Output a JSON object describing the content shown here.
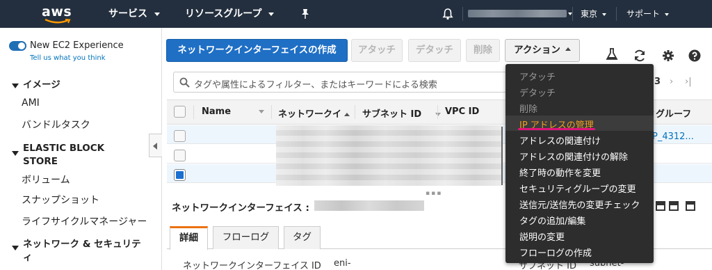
{
  "topbar": {
    "logo": "aws",
    "services": "サービス",
    "resource_groups": "リソースグループ",
    "region": "東京",
    "support": "サポート"
  },
  "sidebar": {
    "new_ec2_label": "New EC2 Experience",
    "tell_us": "Tell us what you think",
    "sections": [
      {
        "title": "イメージ",
        "items": [
          "AMI",
          "バンドルタスク"
        ]
      },
      {
        "title": "ELASTIC BLOCK STORE",
        "items": [
          "ボリューム",
          "スナップショット",
          "ライフサイクルマネージャー"
        ]
      },
      {
        "title": "ネットワーク & セキュリティ",
        "items": []
      }
    ]
  },
  "toolbar": {
    "create_label": "ネットワークインターフェイスの作成",
    "attach_label": "アタッチ",
    "detach_label": "デタッチ",
    "delete_label": "削除",
    "actions_label": "アクション"
  },
  "search": {
    "placeholder": "タグや属性によるフィルター、またはキーワードによる検索",
    "page_fragment": "3"
  },
  "table": {
    "columns": [
      "Name",
      "ネットワークイ",
      "サブネット ID",
      "VPC ID",
      "ィグルーフ"
    ],
    "rows": [
      {
        "selected": false,
        "link": "P_4312..."
      },
      {
        "selected": false,
        "link": ""
      },
      {
        "selected": true,
        "link": ""
      }
    ]
  },
  "details": {
    "title": "ネットワークインターフェイス :",
    "tabs": [
      "詳細",
      "フローログ",
      "タグ"
    ],
    "kv_left_label": "ネットワークインターフェイス ID",
    "kv_left_value": "eni-",
    "kv_right_label": "サブネット ID",
    "kv_right_value": "subnet-"
  },
  "action_menu": {
    "items": [
      {
        "label": "アタッチ",
        "state": "disabled"
      },
      {
        "label": "デタッチ",
        "state": "disabled"
      },
      {
        "label": "削除",
        "state": "disabled"
      },
      {
        "label": "IP アドレスの管理",
        "state": "highlighted"
      },
      {
        "label": "アドレスの関連付け",
        "state": "enabled"
      },
      {
        "label": "アドレスの関連付けの解除",
        "state": "enabled"
      },
      {
        "label": "終了時の動作を変更",
        "state": "enabled"
      },
      {
        "label": "セキュリティグループの変更",
        "state": "enabled"
      },
      {
        "label": "送信元/送信先の変更チェック",
        "state": "enabled"
      },
      {
        "label": "タグの追加/編集",
        "state": "enabled"
      },
      {
        "label": "説明の変更",
        "state": "enabled"
      },
      {
        "label": "フローログの作成",
        "state": "enabled"
      }
    ]
  },
  "colors": {
    "nav_bg": "#232f3e",
    "primary": "#1f6fc5",
    "highlight_text": "#f0a020",
    "annotation_underline": "#e0157a",
    "tab_accent": "#ec7211"
  }
}
